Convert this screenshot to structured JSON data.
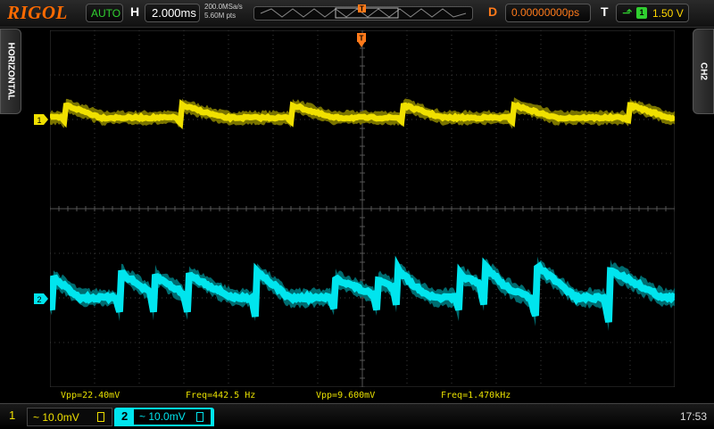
{
  "header": {
    "logo": "RIGOL",
    "run_status": "AUTO",
    "h_label": "H",
    "timebase": "2.000ms",
    "sample_rate": "200.0MSa/s",
    "memory_depth": "5.60M pts",
    "d_label": "D",
    "delay": "0.00000000ps",
    "t_label": "T",
    "trigger_source": "1",
    "trigger_level": "1.50 V"
  },
  "side_tabs": {
    "left": "HORIZONTAL",
    "right": "CH2"
  },
  "markers": {
    "ch1": "1",
    "ch2": "2",
    "trigger": "T"
  },
  "measurements": {
    "m1": "Vpp=22.40mV",
    "m2": "Freq=442.5 Hz",
    "m3": "Vpp=9.600mV",
    "m4": "Freq=1.470kHz"
  },
  "channels": {
    "ch1_num": "1",
    "ch1_scale": "~ 10.0mV",
    "ch2_num": "2",
    "ch2_scale": "~ 10.0mV"
  },
  "clock": "17:53",
  "colors": {
    "ch1": "#f0e000",
    "ch2": "#00e5ee",
    "brand": "#ff6a00",
    "trigger": "#ff7a1a"
  }
}
